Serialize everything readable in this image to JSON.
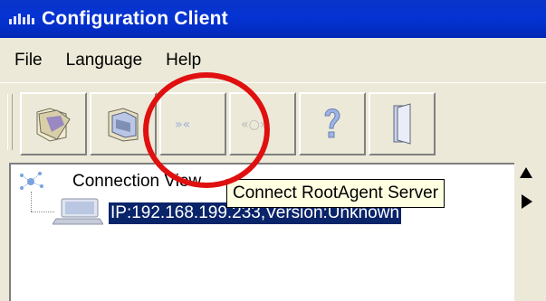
{
  "window": {
    "title": "Configuration Client"
  },
  "menu": {
    "items": [
      "File",
      "Language",
      "Help"
    ]
  },
  "toolbar": {
    "buttons": [
      {
        "icon": "open-folder-icon",
        "enabled": true
      },
      {
        "icon": "save-folder-icon",
        "enabled": true
      },
      {
        "icon": "connect-arrows-icon",
        "enabled": false
      },
      {
        "icon": "disconnect-arrows-icon",
        "enabled": false
      },
      {
        "icon": "help-icon",
        "enabled": true
      },
      {
        "icon": "exit-door-icon",
        "enabled": true
      }
    ]
  },
  "tree": {
    "root_label": "Connection View",
    "child_label": "IP:192.168.199.233,Version:Unknown"
  },
  "tooltip": {
    "text": "Connect RootAgent Server"
  },
  "colors": {
    "titlebar": "#0533d4",
    "selection": "#0a246a",
    "highlight_circle": "#e01010",
    "tooltip_bg": "#ffffe1"
  }
}
